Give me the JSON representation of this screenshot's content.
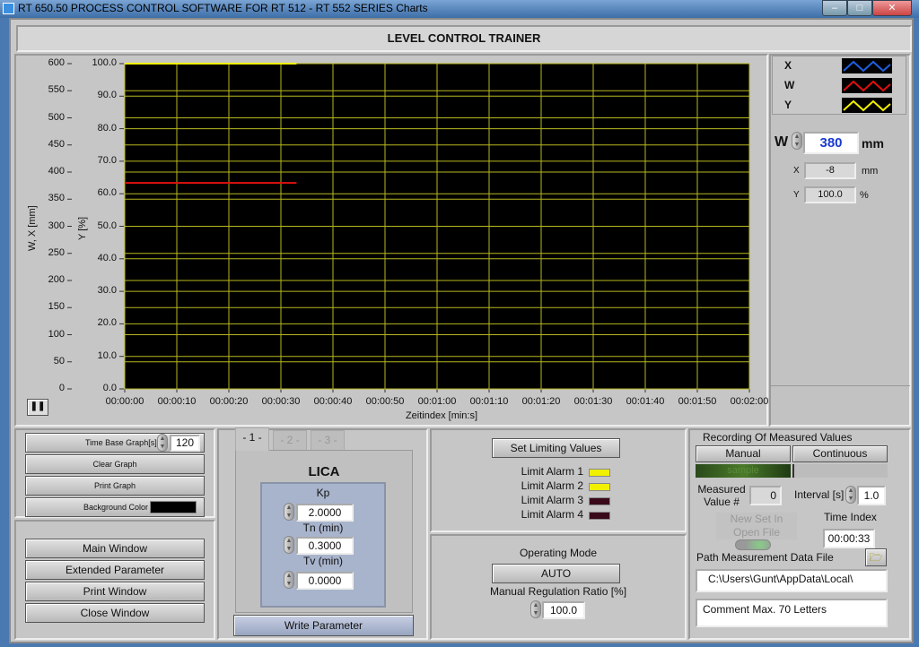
{
  "window": {
    "title": "RT 650.50 PROCESS CONTROL SOFTWARE FOR RT 512 - RT 552 SERIES Charts",
    "controls": [
      "minimize",
      "maximize",
      "close"
    ]
  },
  "header": {
    "title": "LEVEL CONTROL TRAINER"
  },
  "chart_data": {
    "type": "line",
    "xlabel": "Zeitindex [min:s]",
    "ylabel_left": "W, X [mm]",
    "ylabel_right": "Y [%]",
    "xlim": [
      0,
      120
    ],
    "ylim_left": [
      0,
      600
    ],
    "ylim_right": [
      0,
      100
    ],
    "x_ticks": [
      "00:00:00",
      "00:00:10",
      "00:00:20",
      "00:00:30",
      "00:00:40",
      "00:00:50",
      "00:01:00",
      "00:01:10",
      "00:01:20",
      "00:01:30",
      "00:01:40",
      "00:01:50",
      "00:02:00"
    ],
    "y_ticks_left": [
      "0",
      "50",
      "100",
      "150",
      "200",
      "250",
      "300",
      "350",
      "400",
      "450",
      "500",
      "550",
      "600"
    ],
    "y_ticks_right": [
      "0.0",
      "10.0",
      "20.0",
      "30.0",
      "40.0",
      "50.0",
      "60.0",
      "70.0",
      "80.0",
      "90.0",
      "100.0"
    ],
    "grid": true,
    "background": "#000000",
    "grid_color": "#b8b820",
    "series": [
      {
        "name": "X",
        "color": "#1f5fe0",
        "axis": "left",
        "x": [],
        "y": []
      },
      {
        "name": "W",
        "color": "#e01010",
        "axis": "left",
        "x": [
          0,
          33
        ],
        "y": [
          380,
          380
        ]
      },
      {
        "name": "Y",
        "color": "#f0f000",
        "axis": "right",
        "x": [
          0,
          33
        ],
        "y": [
          100,
          100
        ]
      }
    ]
  },
  "legend": [
    {
      "label": "X",
      "color": "#1f5fe0"
    },
    {
      "label": "W",
      "color": "#e01010"
    },
    {
      "label": "Y",
      "color": "#f0f000"
    }
  ],
  "readouts": {
    "w_label": "W",
    "w_value": "380",
    "w_unit": "mm",
    "x_label": "X",
    "x_value": "-8",
    "x_unit": "mm",
    "y_label": "Y",
    "y_value": "100.0",
    "y_unit": "%"
  },
  "graph_controls": {
    "time_base_label": "Time Base Graph[s]",
    "time_base_value": "120",
    "clear": "Clear Graph",
    "print": "Print Graph",
    "bg_color_label": "Background Color",
    "bg_color": "#000000",
    "pause_icon": "pause"
  },
  "nav": [
    "Main Window",
    "Extended Parameter",
    "Print Window",
    "Close Window"
  ],
  "tabs": [
    "- 1 -",
    "- 2 -",
    "- 3 -"
  ],
  "controller": {
    "title": "LICA",
    "kp_label": "Kp",
    "kp": "2.0000",
    "tn_label": "Tn (min)",
    "tn": "0.3000",
    "tv_label": "Tv (min)",
    "tv": "0.0000",
    "write": "Write Parameter"
  },
  "limits": {
    "button": "Set Limiting Values",
    "alarms": [
      {
        "label": "Limit Alarm 1",
        "color": "#f0f000"
      },
      {
        "label": "Limit Alarm 2",
        "color": "#f0f000"
      },
      {
        "label": "Limit Alarm 3",
        "color": "#3a0a1a"
      },
      {
        "label": "Limit Alarm 4",
        "color": "#3a0a1a"
      }
    ]
  },
  "mode": {
    "title": "Operating Mode",
    "button": "AUTO",
    "ratio_label": "Manual Regulation Ratio [%]",
    "ratio": "100.0"
  },
  "recording": {
    "title": "Recording Of Measured Values",
    "manual": "Manual",
    "continuous": "Continuous",
    "sample": "sample",
    "measured_label": "Measured Value #",
    "measured": "0",
    "interval_label": "Interval [s]",
    "interval": "1.0",
    "new_set": "New Set In Open File",
    "time_index_label": "Time Index",
    "time_index": "00:00:33",
    "path_label": "Path Measurement Data File",
    "path": "C:\\Users\\Gunt\\AppData\\Local\\",
    "comment": "Comment Max. 70 Letters"
  }
}
